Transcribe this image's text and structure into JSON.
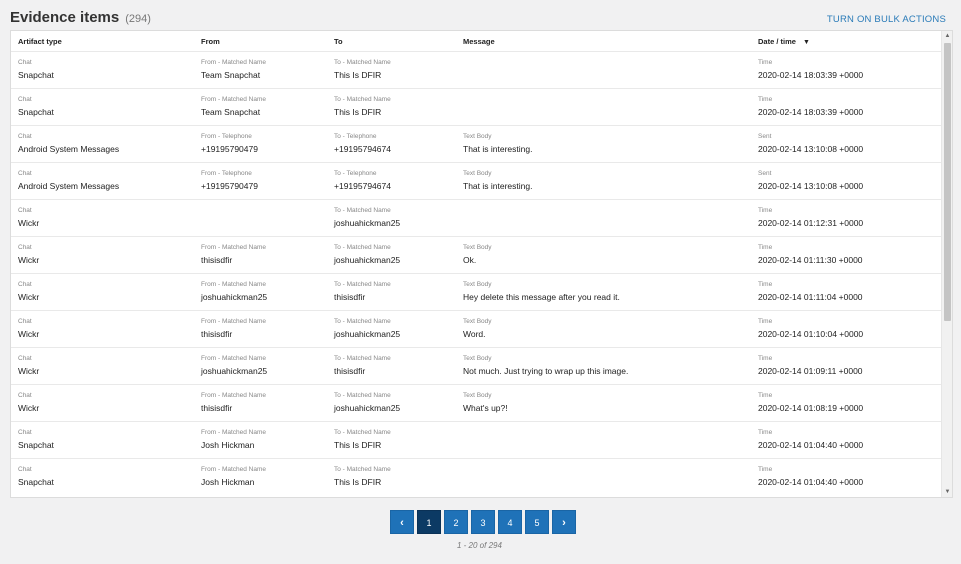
{
  "header": {
    "title": "Evidence items",
    "count": "(294)",
    "bulk_action": "TURN ON BULK ACTIONS"
  },
  "table": {
    "columns": [
      "Artifact type",
      "From",
      "To",
      "Message",
      "Date / time"
    ],
    "rows": [
      {
        "type_label": "Chat",
        "type": "Snapchat",
        "from_label": "From - Matched Name",
        "from": "Team Snapchat",
        "to_label": "To - Matched Name",
        "to": "This Is DFIR",
        "msg_label": "",
        "msg": "",
        "time_label": "Time",
        "time": "2020-02-14 18:03:39 +0000"
      },
      {
        "type_label": "Chat",
        "type": "Snapchat",
        "from_label": "From - Matched Name",
        "from": "Team Snapchat",
        "to_label": "To - Matched Name",
        "to": "This Is DFIR",
        "msg_label": "",
        "msg": "",
        "time_label": "Time",
        "time": "2020-02-14 18:03:39 +0000"
      },
      {
        "type_label": "Chat",
        "type": "Android System Messages",
        "from_label": "From - Telephone",
        "from": "+19195790479",
        "to_label": "To - Telephone",
        "to": "+19195794674",
        "msg_label": "Text Body",
        "msg": "That is interesting.",
        "time_label": "Sent",
        "time": "2020-02-14 13:10:08 +0000"
      },
      {
        "type_label": "Chat",
        "type": "Android System Messages",
        "from_label": "From - Telephone",
        "from": "+19195790479",
        "to_label": "To - Telephone",
        "to": "+19195794674",
        "msg_label": "Text Body",
        "msg": "That is interesting.",
        "time_label": "Sent",
        "time": "2020-02-14 13:10:08 +0000"
      },
      {
        "type_label": "Chat",
        "type": "Wickr",
        "from_label": "",
        "from": "",
        "to_label": "To - Matched Name",
        "to": "joshuahickman25",
        "msg_label": "",
        "msg": "",
        "time_label": "Time",
        "time": "2020-02-14 01:12:31 +0000"
      },
      {
        "type_label": "Chat",
        "type": "Wickr",
        "from_label": "From - Matched Name",
        "from": "thisisdfir",
        "to_label": "To - Matched Name",
        "to": "joshuahickman25",
        "msg_label": "Text Body",
        "msg": "Ok.",
        "time_label": "Time",
        "time": "2020-02-14 01:11:30 +0000"
      },
      {
        "type_label": "Chat",
        "type": "Wickr",
        "from_label": "From - Matched Name",
        "from": "joshuahickman25",
        "to_label": "To - Matched Name",
        "to": "thisisdfir",
        "msg_label": "Text Body",
        "msg": "Hey delete this message after you read it.",
        "time_label": "Time",
        "time": "2020-02-14 01:11:04 +0000"
      },
      {
        "type_label": "Chat",
        "type": "Wickr",
        "from_label": "From - Matched Name",
        "from": "thisisdfir",
        "to_label": "To - Matched Name",
        "to": "joshuahickman25",
        "msg_label": "Text Body",
        "msg": "Word.",
        "time_label": "Time",
        "time": "2020-02-14 01:10:04 +0000"
      },
      {
        "type_label": "Chat",
        "type": "Wickr",
        "from_label": "From - Matched Name",
        "from": "joshuahickman25",
        "to_label": "To - Matched Name",
        "to": "thisisdfir",
        "msg_label": "Text Body",
        "msg": "Not much. Just trying to wrap up this image.",
        "time_label": "Time",
        "time": "2020-02-14 01:09:11 +0000"
      },
      {
        "type_label": "Chat",
        "type": "Wickr",
        "from_label": "From - Matched Name",
        "from": "thisisdfir",
        "to_label": "To - Matched Name",
        "to": "joshuahickman25",
        "msg_label": "Text Body",
        "msg": "What's up?!",
        "time_label": "Time",
        "time": "2020-02-14 01:08:19 +0000"
      },
      {
        "type_label": "Chat",
        "type": "Snapchat",
        "from_label": "From - Matched Name",
        "from": "Josh Hickman",
        "to_label": "To - Matched Name",
        "to": "This Is DFIR",
        "msg_label": "",
        "msg": "",
        "time_label": "Time",
        "time": "2020-02-14 01:04:40 +0000"
      },
      {
        "type_label": "Chat",
        "type": "Snapchat",
        "from_label": "From - Matched Name",
        "from": "Josh Hickman",
        "to_label": "To - Matched Name",
        "to": "This Is DFIR",
        "msg_label": "",
        "msg": "",
        "time_label": "Time",
        "time": "2020-02-14 01:04:40 +0000"
      }
    ]
  },
  "pagination": {
    "prev": "‹",
    "pages": [
      "1",
      "2",
      "3",
      "4",
      "5"
    ],
    "active": "1",
    "next": "›",
    "info": "1 - 20 of 294"
  }
}
